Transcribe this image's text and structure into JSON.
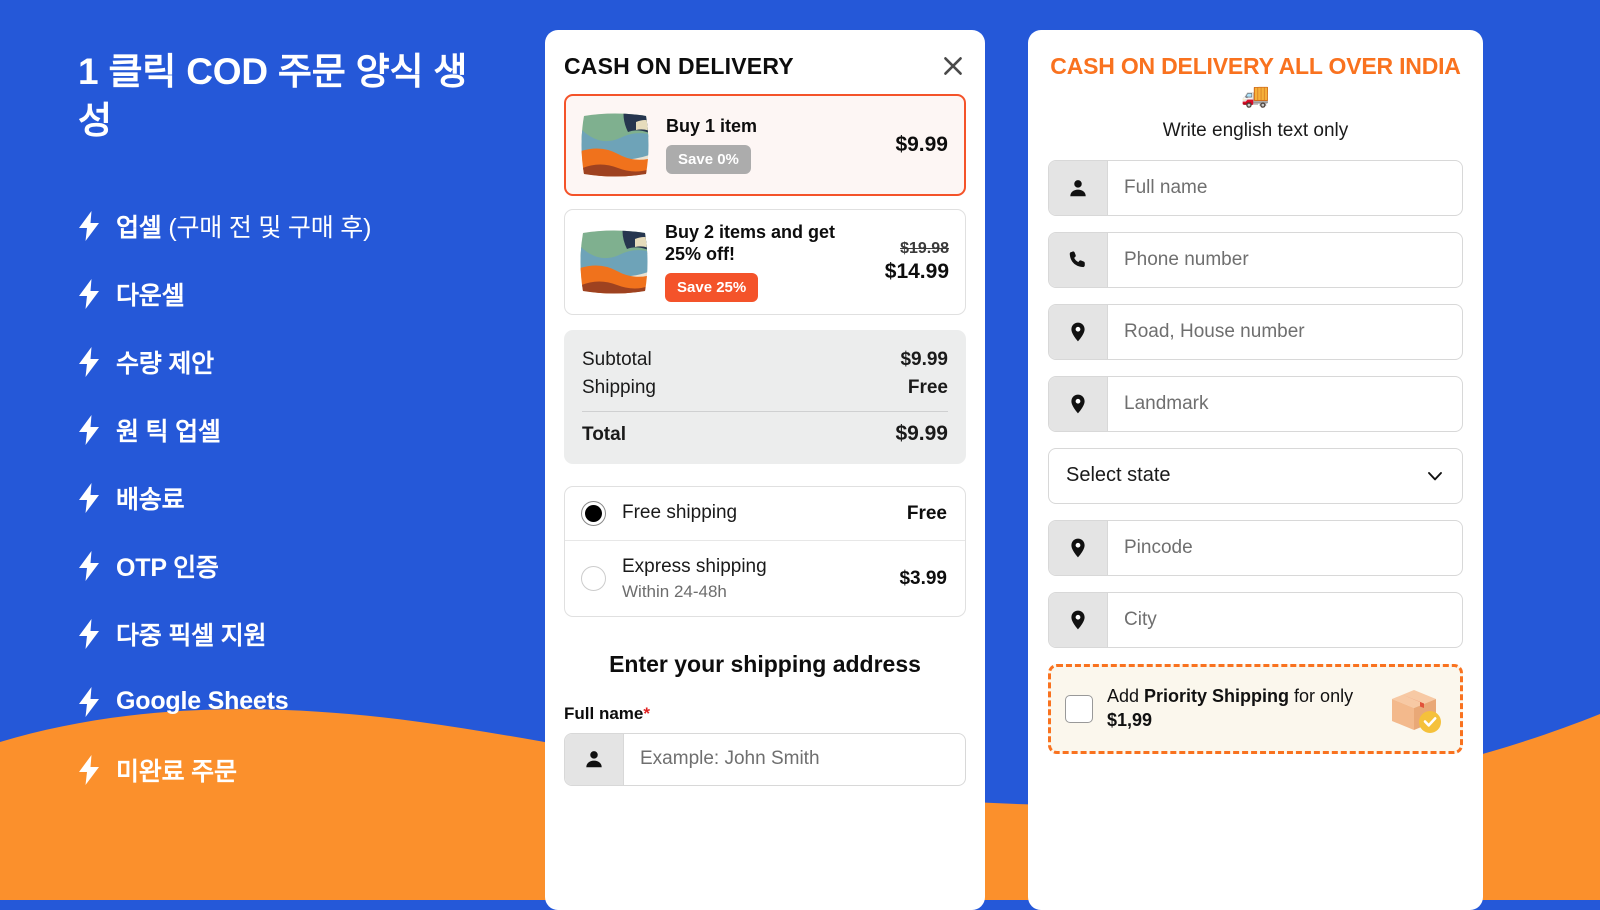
{
  "theme": {
    "blue": "#2558d8",
    "orange": "#fb902c",
    "accent_orange": "#f9721f",
    "badge_red": "#f4532a",
    "badge_grey": "#acacac"
  },
  "promo": {
    "title": "1 클릭 COD 주문 양식 생성",
    "features": [
      {
        "icon": "bolt-icon",
        "label": "업셀",
        "suffix": " (구매 전 및 구매 후)"
      },
      {
        "icon": "bolt-icon",
        "label": "다운셀",
        "suffix": ""
      },
      {
        "icon": "bolt-icon",
        "label": "수량 제안",
        "suffix": ""
      },
      {
        "icon": "bolt-icon",
        "label": "원 틱 업셀",
        "suffix": ""
      },
      {
        "icon": "bolt-icon",
        "label": "배송료",
        "suffix": ""
      },
      {
        "icon": "bolt-icon",
        "label": "OTP 인증",
        "suffix": ""
      },
      {
        "icon": "bolt-icon",
        "label": "다중 픽셀 지원",
        "suffix": ""
      },
      {
        "icon": "bolt-icon",
        "label": "Google Sheets",
        "suffix": ""
      },
      {
        "icon": "bolt-icon",
        "label": "미완료 주문",
        "suffix": ""
      }
    ]
  },
  "cart": {
    "title": "CASH ON DELIVERY",
    "close_icon": "close-icon",
    "offers": [
      {
        "name": "Buy 1 item",
        "badge": "Save 0%",
        "badge_style": "grey",
        "compare_price": "",
        "price": "$9.99",
        "selected": true
      },
      {
        "name": "Buy 2 items and get 25% off!",
        "badge": "Save 25%",
        "badge_style": "orange",
        "compare_price": "$19.98",
        "price": "$14.99",
        "selected": false
      }
    ],
    "summary": {
      "subtotal_label": "Subtotal",
      "subtotal_value": "$9.99",
      "shipping_label": "Shipping",
      "shipping_value": "Free",
      "total_label": "Total",
      "total_value": "$9.99"
    },
    "shipping_methods": [
      {
        "name": "Free shipping",
        "sub": "",
        "price": "Free",
        "selected": true
      },
      {
        "name": "Express shipping",
        "sub": "Within 24-48h",
        "price": "$3.99",
        "selected": false
      }
    ],
    "address_heading": "Enter your shipping address",
    "fullname_label": "Full name",
    "required_mark": "*",
    "fullname_placeholder": "Example: John Smith",
    "fullname_value": ""
  },
  "cod": {
    "title": "CASH ON DELIVERY ALL OVER INDIA 🚚",
    "subtitle": "Write english text only",
    "fields": [
      {
        "icon": "person-icon",
        "placeholder": "Full name",
        "value": ""
      },
      {
        "icon": "phone-icon",
        "placeholder": "Phone number",
        "value": ""
      },
      {
        "icon": "location-pin-icon",
        "placeholder": "Road, House number",
        "value": ""
      },
      {
        "icon": "location-pin-icon",
        "placeholder": "Landmark",
        "value": ""
      }
    ],
    "state_select": {
      "value": "Select state",
      "icon": "chevron-down-icon"
    },
    "fields2": [
      {
        "icon": "location-pin-icon",
        "placeholder": "Pincode",
        "value": ""
      },
      {
        "icon": "location-pin-icon",
        "placeholder": "City",
        "value": ""
      }
    ],
    "priority": {
      "text_pre": "Add ",
      "text_bold1": "Priority Shipping",
      "text_mid": " for only ",
      "text_bold2": "$1,99",
      "icon": "package-shield-icon",
      "checked": false
    }
  }
}
